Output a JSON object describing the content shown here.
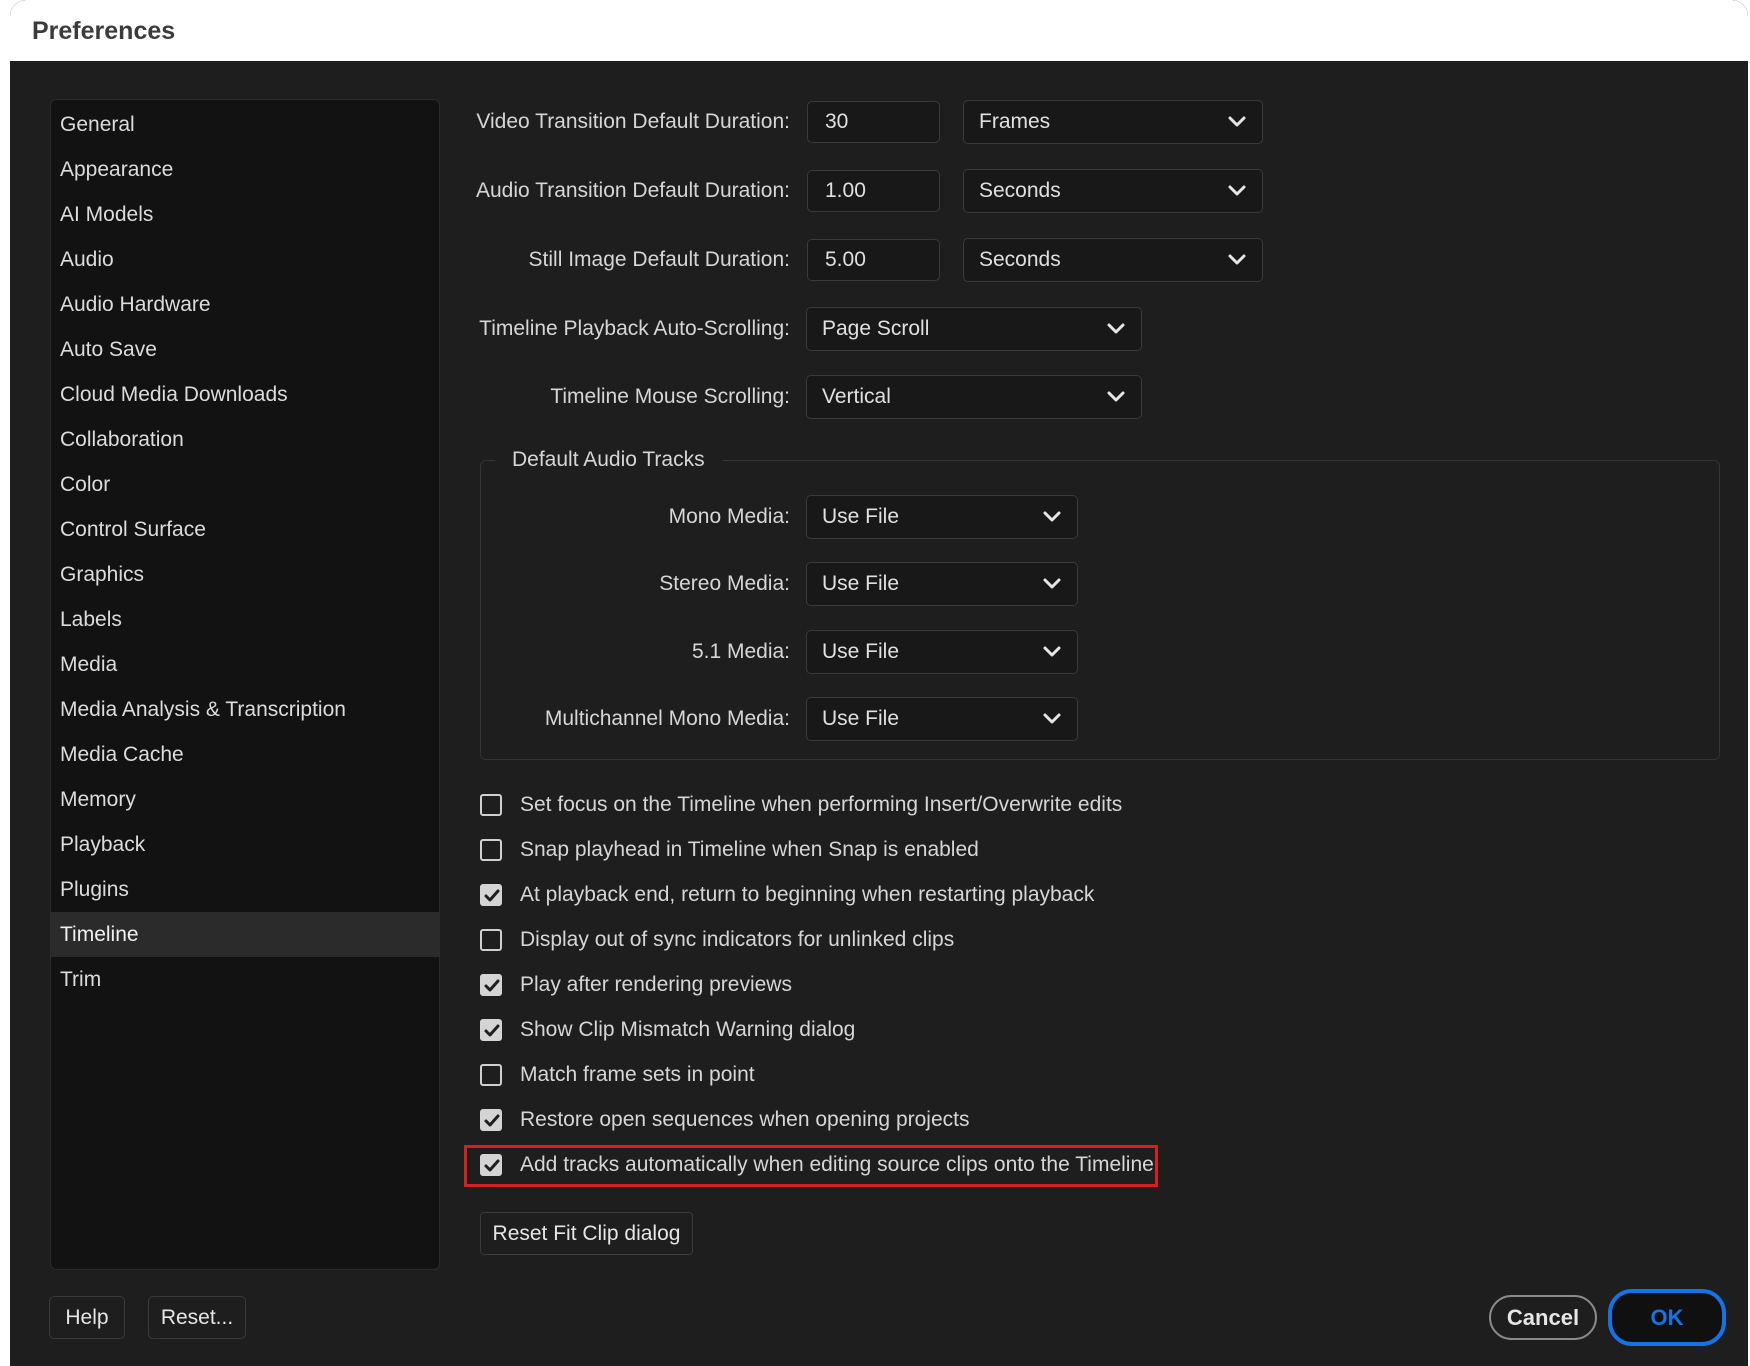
{
  "window": {
    "title": "Preferences"
  },
  "sidebar": {
    "items": [
      {
        "label": "General"
      },
      {
        "label": "Appearance"
      },
      {
        "label": "AI Models"
      },
      {
        "label": "Audio"
      },
      {
        "label": "Audio Hardware"
      },
      {
        "label": "Auto Save"
      },
      {
        "label": "Cloud Media Downloads"
      },
      {
        "label": "Collaboration"
      },
      {
        "label": "Color"
      },
      {
        "label": "Control Surface"
      },
      {
        "label": "Graphics"
      },
      {
        "label": "Labels"
      },
      {
        "label": "Media"
      },
      {
        "label": "Media Analysis & Transcription"
      },
      {
        "label": "Media Cache"
      },
      {
        "label": "Memory"
      },
      {
        "label": "Playback"
      },
      {
        "label": "Plugins"
      },
      {
        "label": "Timeline"
      },
      {
        "label": "Trim"
      }
    ],
    "selected": "Timeline"
  },
  "durations": {
    "video": {
      "label": "Video Transition Default Duration:",
      "value": "30",
      "unit": "Frames"
    },
    "audio": {
      "label": "Audio Transition Default Duration:",
      "value": "1.00",
      "unit": "Seconds"
    },
    "still": {
      "label": "Still Image Default Duration:",
      "value": "5.00",
      "unit": "Seconds"
    }
  },
  "scrolling": {
    "autoscroll": {
      "label": "Timeline Playback Auto-Scrolling:",
      "value": "Page Scroll"
    },
    "mouse": {
      "label": "Timeline Mouse Scrolling:",
      "value": "Vertical"
    }
  },
  "audio_tracks": {
    "title": "Default Audio Tracks",
    "mono": {
      "label": "Mono Media:",
      "value": "Use File"
    },
    "stereo": {
      "label": "Stereo Media:",
      "value": "Use File"
    },
    "surround": {
      "label": "5.1 Media:",
      "value": "Use File"
    },
    "multichannel": {
      "label": "Multichannel Mono Media:",
      "value": "Use File"
    }
  },
  "checkboxes": [
    {
      "label": "Set focus on the Timeline when performing Insert/Overwrite edits",
      "checked": false
    },
    {
      "label": "Snap playhead in Timeline when Snap is enabled",
      "checked": false
    },
    {
      "label": "At playback end, return to beginning when restarting playback",
      "checked": true
    },
    {
      "label": "Display out of sync indicators for unlinked clips",
      "checked": false
    },
    {
      "label": "Play after rendering previews",
      "checked": true
    },
    {
      "label": "Show Clip Mismatch Warning dialog",
      "checked": true
    },
    {
      "label": "Match frame sets in point",
      "checked": false
    },
    {
      "label": "Restore open sequences when opening projects",
      "checked": true
    },
    {
      "label": "Add tracks automatically when editing source clips onto the Timeline",
      "checked": true
    }
  ],
  "buttons": {
    "reset_fit_clip": "Reset Fit Clip dialog",
    "help": "Help",
    "reset": "Reset...",
    "cancel": "Cancel",
    "ok": "OK"
  },
  "colors": {
    "background": "#1e1e1e",
    "sidebar": "#121212",
    "selected_item": "#2b2b2b",
    "accent_blue": "#1473e6",
    "highlight_red": "#d81f1f"
  }
}
